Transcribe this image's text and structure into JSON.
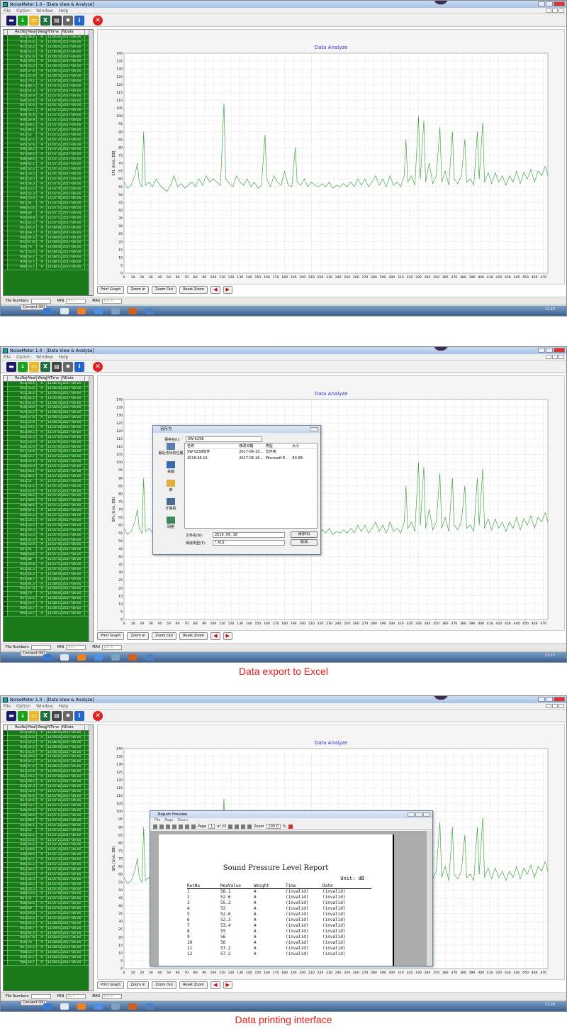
{
  "app": {
    "title": "NoiseMeter 1.0 - [Data View & Analyze]",
    "menu": [
      "File",
      "Option",
      "Window",
      "Help"
    ],
    "toolbar_icons": [
      {
        "name": "monitor-icon",
        "color": "#1a1a6a",
        "glyph": "▬"
      },
      {
        "name": "download-icon",
        "color": "#18a018",
        "glyph": "↓"
      },
      {
        "name": "folder-open-icon",
        "color": "#e8b830",
        "glyph": "▭"
      },
      {
        "name": "excel-export-icon",
        "color": "#1d6f42",
        "glyph": "X"
      },
      {
        "name": "printer-icon",
        "color": "#444444",
        "glyph": "▤"
      },
      {
        "name": "settings-gear-icon",
        "color": "#666666",
        "glyph": "✹"
      },
      {
        "name": "info-icon",
        "color": "#2266cc",
        "glyph": "i"
      }
    ],
    "exit_glyph": "✕"
  },
  "grid": {
    "columns": [
      "RecNo",
      "MeaVal",
      "Weigh",
      "NTime",
      "NDate"
    ],
    "rows": [
      [
        "913",
        "58.4",
        "A",
        "11:06:43",
        "2017-06-16"
      ],
      [
        "914",
        "55.6",
        "A",
        "11:06:45",
        "2017-06-16"
      ],
      [
        "915",
        "54.2",
        "A",
        "11:06:47",
        "2017-06-16"
      ],
      [
        "916",
        "54.5",
        "A",
        "11:06:49",
        "2017-06-16"
      ],
      [
        "917",
        "61.6",
        "A",
        "11:06:51",
        "2017-06-16"
      ],
      [
        "918",
        "59.6",
        "A",
        "11:06:53",
        "2017-06-16"
      ],
      [
        "919",
        "55.2",
        "A",
        "11:06:55",
        "2017-06-16"
      ],
      [
        "920",
        "57.6",
        "A",
        "11:06:57",
        "2017-06-16"
      ],
      [
        "921",
        "55.9",
        "A",
        "11:06:59",
        "2017-06-16"
      ],
      [
        "922",
        "70.1",
        "A",
        "11:07:01",
        "2017-06-16"
      ],
      [
        "923",
        "60.5",
        "A",
        "11:07:03",
        "2017-06-16"
      ],
      [
        "924",
        "54.3",
        "A",
        "11:07:05",
        "2017-06-16"
      ],
      [
        "925",
        "53.9",
        "A",
        "11:07:07",
        "2017-06-16"
      ],
      [
        "926",
        "54.6",
        "A",
        "11:07:09",
        "2017-06-16"
      ],
      [
        "927",
        "54.6",
        "A",
        "11:07:11",
        "2017-06-16"
      ],
      [
        "928",
        "53.7",
        "A",
        "11:07:13",
        "2017-06-16"
      ],
      [
        "929",
        "54.4",
        "A",
        "11:07:15",
        "2017-06-16"
      ],
      [
        "930",
        "56.9",
        "A",
        "11:07:17",
        "2017-06-16"
      ],
      [
        "931",
        "66.1",
        "A",
        "11:07:19",
        "2017-06-16"
      ],
      [
        "932",
        "66.1",
        "A",
        "11:07:21",
        "2017-06-16"
      ],
      [
        "933",
        "52",
        "A",
        "11:07:23",
        "2017-06-16"
      ],
      [
        "934",
        "52.1",
        "A",
        "11:07:25",
        "2017-06-16"
      ],
      [
        "935",
        "52.6",
        "A",
        "11:07:27",
        "2017-06-16"
      ],
      [
        "936",
        "56.2",
        "A",
        "11:07:29",
        "2017-06-16"
      ],
      [
        "937",
        "68.6",
        "A",
        "11:07:31",
        "2017-06-16"
      ],
      [
        "938",
        "68.6",
        "A",
        "11:07:33",
        "2017-06-16"
      ],
      [
        "939",
        "62.1",
        "A",
        "11:07:35",
        "2017-06-16"
      ],
      [
        "940",
        "52.2",
        "A",
        "11:07:37",
        "2017-06-16"
      ],
      [
        "941",
        "53.5",
        "A",
        "11:07:39",
        "2017-06-16"
      ],
      [
        "942",
        "53.5",
        "A",
        "11:07:41",
        "2017-06-16"
      ],
      [
        "943",
        "56.3",
        "A",
        "11:07:43",
        "2017-06-16"
      ],
      [
        "944",
        "53.5",
        "A",
        "11:07:45",
        "2017-06-16"
      ],
      [
        "945",
        "55.3",
        "A",
        "11:07:47",
        "2017-06-16"
      ],
      [
        "946",
        "53.4",
        "A",
        "11:07:49",
        "2017-06-16"
      ],
      [
        "947",
        "54",
        "A",
        "11:07:51",
        "2017-06-16"
      ],
      [
        "948",
        "63.6",
        "A",
        "11:07:53",
        "2017-06-16"
      ],
      [
        "949",
        "68",
        "A",
        "11:07:55",
        "2017-06-16"
      ],
      [
        "950",
        "66.8",
        "A",
        "11:07:57",
        "2017-06-16"
      ],
      [
        "951",
        "62.5",
        "A",
        "11:07:59",
        "2017-06-16"
      ],
      [
        "952",
        "65.2",
        "A",
        "11:08:01",
        "2017-06-16"
      ],
      [
        "953",
        "68.7",
        "A",
        "11:08:03",
        "2017-06-16"
      ],
      [
        "954",
        "64.3",
        "A",
        "11:08:05",
        "2017-06-16"
      ],
      [
        "955",
        "67.8",
        "A",
        "11:08:07",
        "2017-06-16"
      ],
      [
        "956",
        "70",
        "A",
        "11:08:09",
        "2017-06-16"
      ],
      [
        "957",
        "55.5",
        "A",
        "11:08:11",
        "2017-06-16"
      ],
      [
        "958",
        "53.7",
        "A",
        "11:08:13",
        "2017-06-16"
      ],
      [
        "959",
        "53.7",
        "A",
        "11:08:15",
        "2017-06-16"
      ],
      [
        "960",
        "53.7",
        "A",
        "11:08:17",
        "2017-06-16"
      ]
    ]
  },
  "chart_buttons": [
    "Print Graph",
    "Zoom In",
    "Zoom Out",
    "Reset Zoom"
  ],
  "status": {
    "file_numbers_label": "File Numbers",
    "min_label": "MIN",
    "min_value": "50.3",
    "max_label": "MAX",
    "max_value": "107.6",
    "connect_label": "Connect OK!",
    "clocks": [
      "11:20",
      "11:22",
      "11:26"
    ]
  },
  "chart_data": {
    "type": "line",
    "title": "Data Analyze",
    "ylabel": "SPL (Unit: DB)",
    "xlim": [
      0,
      475
    ],
    "ylim": [
      0,
      140
    ],
    "x_ticks": [
      0,
      10,
      20,
      30,
      40,
      50,
      60,
      70,
      80,
      90,
      100,
      110,
      120,
      130,
      140,
      150,
      160,
      170,
      180,
      190,
      200,
      210,
      220,
      230,
      240,
      250,
      260,
      270,
      280,
      290,
      300,
      310,
      320,
      330,
      340,
      350,
      360,
      370,
      380,
      390,
      400,
      410,
      420,
      430,
      440,
      450,
      460,
      470
    ],
    "y_ticks": [
      0,
      5,
      10,
      15,
      20,
      25,
      30,
      35,
      40,
      45,
      50,
      55,
      60,
      65,
      70,
      75,
      80,
      85,
      90,
      95,
      100,
      105,
      110,
      115,
      120,
      125,
      130,
      135,
      140
    ],
    "grid": true,
    "series": [
      {
        "color": "#2a9a2a",
        "points": [
          [
            0,
            58
          ],
          [
            4,
            54
          ],
          [
            8,
            56
          ],
          [
            12,
            62
          ],
          [
            15,
            70
          ],
          [
            17,
            58
          ],
          [
            20,
            55
          ],
          [
            22,
            90
          ],
          [
            24,
            56
          ],
          [
            28,
            58
          ],
          [
            32,
            55
          ],
          [
            36,
            60
          ],
          [
            40,
            56
          ],
          [
            44,
            54
          ],
          [
            48,
            52
          ],
          [
            52,
            56
          ],
          [
            56,
            62
          ],
          [
            60,
            55
          ],
          [
            64,
            57
          ],
          [
            68,
            54
          ],
          [
            72,
            56
          ],
          [
            76,
            58
          ],
          [
            80,
            55
          ],
          [
            84,
            60
          ],
          [
            88,
            56
          ],
          [
            92,
            62
          ],
          [
            96,
            58
          ],
          [
            100,
            60
          ],
          [
            104,
            58
          ],
          [
            108,
            56
          ],
          [
            112,
            108
          ],
          [
            114,
            60
          ],
          [
            118,
            57
          ],
          [
            122,
            55
          ],
          [
            126,
            62
          ],
          [
            130,
            58
          ],
          [
            134,
            56
          ],
          [
            138,
            60
          ],
          [
            142,
            55
          ],
          [
            146,
            58
          ],
          [
            150,
            54
          ],
          [
            154,
            56
          ],
          [
            158,
            88
          ],
          [
            160,
            60
          ],
          [
            164,
            55
          ],
          [
            168,
            62
          ],
          [
            172,
            58
          ],
          [
            176,
            56
          ],
          [
            180,
            65
          ],
          [
            184,
            56
          ],
          [
            188,
            55
          ],
          [
            192,
            80
          ],
          [
            194,
            58
          ],
          [
            198,
            56
          ],
          [
            202,
            60
          ],
          [
            206,
            55
          ],
          [
            210,
            58
          ],
          [
            214,
            56
          ],
          [
            218,
            55
          ],
          [
            222,
            57
          ],
          [
            226,
            55
          ],
          [
            230,
            58
          ],
          [
            234,
            54
          ],
          [
            238,
            56
          ],
          [
            242,
            55
          ],
          [
            246,
            57
          ],
          [
            250,
            55
          ],
          [
            254,
            58
          ],
          [
            258,
            55
          ],
          [
            262,
            60
          ],
          [
            266,
            56
          ],
          [
            270,
            60
          ],
          [
            274,
            55
          ],
          [
            278,
            58
          ],
          [
            282,
            62
          ],
          [
            286,
            56
          ],
          [
            290,
            60
          ],
          [
            294,
            55
          ],
          [
            298,
            62
          ],
          [
            302,
            56
          ],
          [
            306,
            58
          ],
          [
            310,
            55
          ],
          [
            314,
            62
          ],
          [
            316,
            85
          ],
          [
            318,
            58
          ],
          [
            322,
            62
          ],
          [
            326,
            56
          ],
          [
            330,
            100
          ],
          [
            332,
            60
          ],
          [
            336,
            97
          ],
          [
            338,
            58
          ],
          [
            342,
            70
          ],
          [
            346,
            57
          ],
          [
            350,
            62
          ],
          [
            354,
            93
          ],
          [
            356,
            58
          ],
          [
            360,
            65
          ],
          [
            364,
            56
          ],
          [
            368,
            90
          ],
          [
            370,
            60
          ],
          [
            374,
            57
          ],
          [
            378,
            62
          ],
          [
            382,
            85
          ],
          [
            384,
            58
          ],
          [
            388,
            60
          ],
          [
            392,
            56
          ],
          [
            396,
            90
          ],
          [
            398,
            60
          ],
          [
            402,
            96
          ],
          [
            404,
            58
          ],
          [
            408,
            64
          ],
          [
            412,
            57
          ],
          [
            416,
            64
          ],
          [
            420,
            58
          ],
          [
            424,
            62
          ],
          [
            428,
            56
          ],
          [
            432,
            62
          ],
          [
            436,
            58
          ],
          [
            440,
            65
          ],
          [
            444,
            57
          ],
          [
            448,
            64
          ],
          [
            452,
            60
          ],
          [
            456,
            66
          ],
          [
            460,
            58
          ],
          [
            464,
            65
          ],
          [
            468,
            62
          ],
          [
            472,
            68
          ],
          [
            475,
            62
          ]
        ]
      }
    ]
  },
  "save_dialog": {
    "title": "另存为",
    "save_in_label": "保存在(I):",
    "save_in_value": "SW-5258",
    "places": [
      "最近访问的位置",
      "桌面",
      "库",
      "计算机",
      "网络"
    ],
    "columns": [
      "名称",
      "修改日期",
      "类型",
      "大小"
    ],
    "files": [
      [
        "SW-5258软件",
        "2017-06-15...",
        "文件夹",
        ""
      ],
      [
        "2016.06.16",
        "2017-06-16...",
        "Microsoft E...",
        "80 KB"
      ]
    ],
    "filename_label": "文件名(N):",
    "filename_value": "2016. 06. 16",
    "filetype_label": "保存类型(T):",
    "filetype_value": "*.XLS",
    "save_button": "保存(S)",
    "cancel_button": "取消"
  },
  "report_preview": {
    "title": "Report Preview",
    "menu": [
      "File",
      "Page",
      "Zoom"
    ],
    "page_label": "Page",
    "page_value": "1",
    "page_total": "of 23",
    "zoom_label": "Zoom",
    "zoom_value": "100.0",
    "zoom_unit": "%",
    "report_title": "Sound Pressure Level Report",
    "unit": "Unit: dB",
    "columns": [
      "RecNo",
      "MeaValue",
      "Weight",
      "Time",
      "Date"
    ],
    "rows": [
      [
        "1",
        "58.1",
        "A",
        "(invalid)",
        "(invalid)"
      ],
      [
        "2",
        "52.6",
        "A",
        "(invalid)",
        "(invalid)"
      ],
      [
        "3",
        "55.2",
        "A",
        "(invalid)",
        "(invalid)"
      ],
      [
        "4",
        "53",
        "A",
        "(invalid)",
        "(invalid)"
      ],
      [
        "5",
        "52.6",
        "A",
        "(invalid)",
        "(invalid)"
      ],
      [
        "6",
        "52.3",
        "A",
        "(invalid)",
        "(invalid)"
      ],
      [
        "7",
        "53.4",
        "A",
        "(invalid)",
        "(invalid)"
      ],
      [
        "8",
        "55",
        "A",
        "(invalid)",
        "(invalid)"
      ],
      [
        "9",
        "56",
        "A",
        "(invalid)",
        "(invalid)"
      ],
      [
        "10",
        "56",
        "A",
        "(invalid)",
        "(invalid)"
      ],
      [
        "11",
        "57.2",
        "A",
        "(invalid)",
        "(invalid)"
      ],
      [
        "12",
        "57.2",
        "A",
        "(invalid)",
        "(invalid)"
      ]
    ]
  },
  "captions": [
    "Data export to Excel",
    "Data printing interface"
  ]
}
